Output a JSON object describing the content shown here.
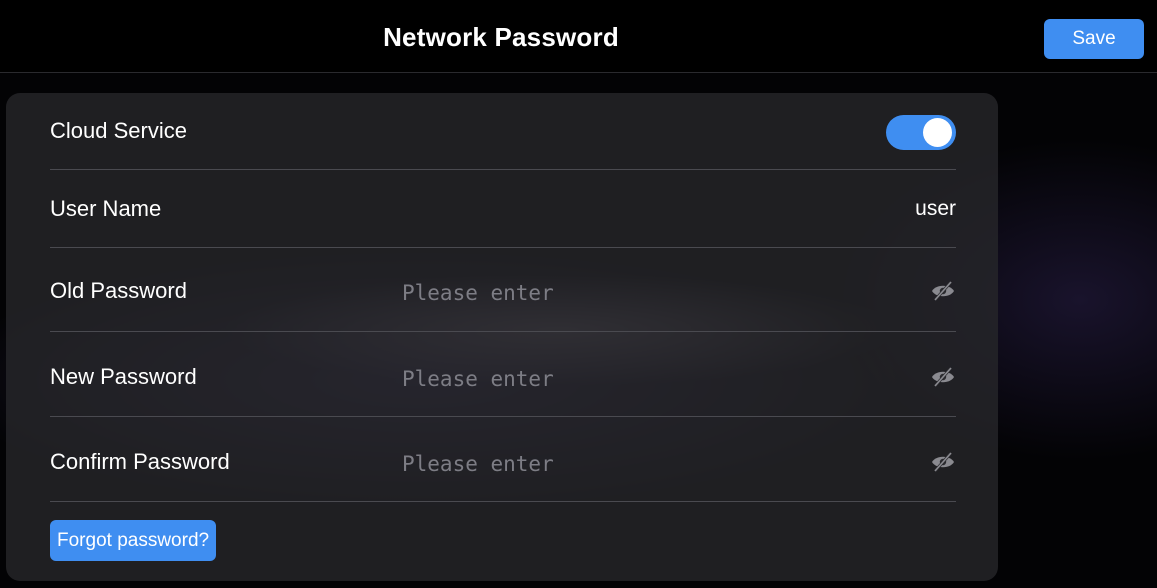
{
  "header": {
    "title": "Network Password",
    "save_label": "Save"
  },
  "form": {
    "cloud_service": {
      "label": "Cloud Service",
      "enabled": true
    },
    "user_name": {
      "label": "User Name",
      "value": "user"
    },
    "old_password": {
      "label": "Old Password",
      "placeholder": "Please enter",
      "icon": "eye-off-icon"
    },
    "new_password": {
      "label": "New Password",
      "placeholder": "Please enter",
      "icon": "eye-off-icon"
    },
    "confirm_password": {
      "label": "Confirm Password",
      "placeholder": "Please enter",
      "icon": "eye-off-icon"
    },
    "forgot_label": "Forgot password?"
  },
  "colors": {
    "accent": "#3f8ef1",
    "background": "#000000",
    "card": "#26262a"
  }
}
